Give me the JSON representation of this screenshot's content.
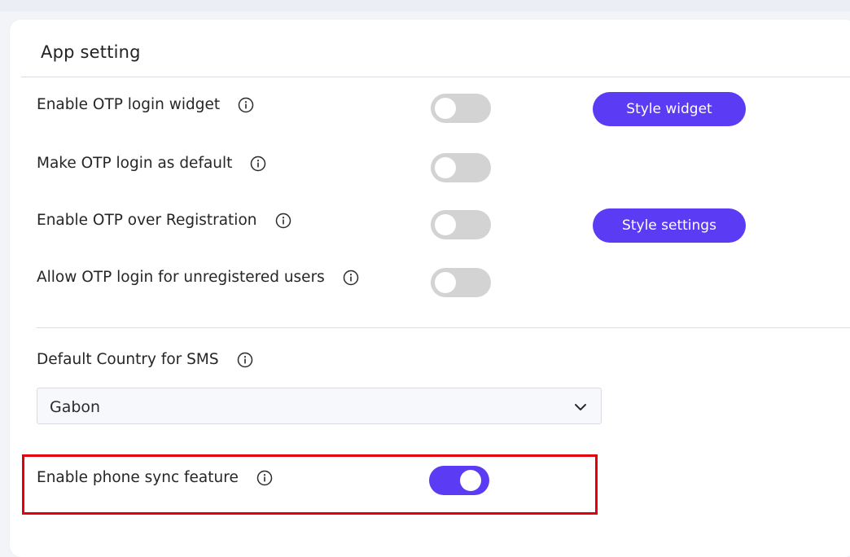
{
  "panel": {
    "title": "App setting"
  },
  "settings": {
    "otp_login_widget": {
      "label": "Enable OTP login widget",
      "enabled": false
    },
    "otp_default": {
      "label": "Make OTP login as default",
      "enabled": false
    },
    "otp_registration": {
      "label": "Enable OTP over Registration",
      "enabled": false
    },
    "otp_unregistered": {
      "label": "Allow OTP login for unregistered users",
      "enabled": false
    },
    "phone_sync": {
      "label": "Enable phone sync feature",
      "enabled": true
    }
  },
  "buttons": {
    "style_widget": "Style widget",
    "style_settings": "Style settings"
  },
  "sms_country": {
    "label": "Default Country for SMS",
    "selected": "Gabon"
  },
  "colors": {
    "accent": "#5b3bf4",
    "toggle_off": "#d3d3d3",
    "highlight": "#e3000b"
  },
  "icons": {
    "info": "info-circle-icon",
    "dropdown": "chevron-down-icon"
  }
}
